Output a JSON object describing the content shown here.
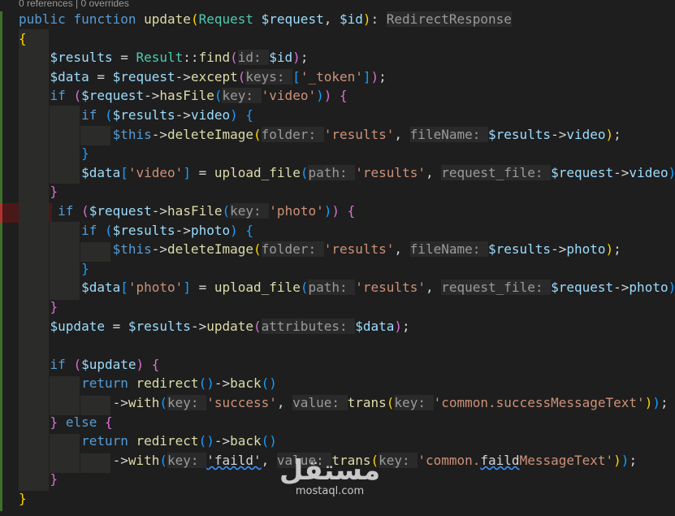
{
  "codelens": {
    "text": "0 references | 0 overrides"
  },
  "colors": {
    "background": "#1e1e1e",
    "keyword": "#569cd6",
    "function": "#dcdcaa",
    "class": "#4ec9b0",
    "variable": "#9cdcfe",
    "string": "#ce9178",
    "inlay_hint": "#9a9a9a",
    "bracket_gold": "#ffd700",
    "bracket_purple": "#da70d6",
    "bracket_blue": "#179fff",
    "gutter_modified": "#3f6f29",
    "gutter_deleted": "#b0342c"
  },
  "watermark": {
    "logo": "مستقل",
    "url": "mostaql.com"
  },
  "code_lines": [
    [
      [
        "kw",
        "public "
      ],
      [
        "kw",
        "function "
      ],
      [
        "fn",
        "update"
      ],
      [
        "b1",
        "("
      ],
      [
        "cls",
        "Request "
      ],
      [
        "var",
        "$request"
      ],
      [
        "p",
        ", "
      ],
      [
        "var",
        "$id"
      ],
      [
        "b1",
        ")"
      ],
      [
        "p",
        ": "
      ],
      [
        "hint",
        "RedirectResponse"
      ]
    ],
    [
      [
        "b1",
        "{"
      ]
    ],
    [
      [
        "p",
        "    "
      ],
      [
        "var",
        "$results"
      ],
      [
        "p",
        " = "
      ],
      [
        "cls",
        "Result"
      ],
      [
        "p",
        "::"
      ],
      [
        "fn",
        "find"
      ],
      [
        "b2",
        "("
      ],
      [
        "hint",
        "id: "
      ],
      [
        "var",
        "$id"
      ],
      [
        "b2",
        ")"
      ],
      [
        "p",
        ";"
      ]
    ],
    [
      [
        "p",
        "    "
      ],
      [
        "var",
        "$data"
      ],
      [
        "p",
        " = "
      ],
      [
        "var",
        "$request"
      ],
      [
        "p",
        "->"
      ],
      [
        "fn",
        "except"
      ],
      [
        "b2",
        "("
      ],
      [
        "hint",
        "keys: "
      ],
      [
        "b3",
        "["
      ],
      [
        "str",
        "'_token'"
      ],
      [
        "b3",
        "]"
      ],
      [
        "b2",
        ")"
      ],
      [
        "p",
        ";"
      ]
    ],
    [
      [
        "p",
        "    "
      ],
      [
        "kw",
        "if "
      ],
      [
        "b2",
        "("
      ],
      [
        "var",
        "$request"
      ],
      [
        "p",
        "->"
      ],
      [
        "fn",
        "hasFile"
      ],
      [
        "b3",
        "("
      ],
      [
        "hint",
        "key: "
      ],
      [
        "str",
        "'video'"
      ],
      [
        "b3",
        ")"
      ],
      [
        "b2",
        ")"
      ],
      [
        "p",
        " "
      ],
      [
        "b2",
        "{"
      ]
    ],
    [
      [
        "p",
        "        "
      ],
      [
        "kw",
        "if "
      ],
      [
        "b3",
        "("
      ],
      [
        "var",
        "$results"
      ],
      [
        "p",
        "->"
      ],
      [
        "var",
        "video"
      ],
      [
        "b3",
        ")"
      ],
      [
        "p",
        " "
      ],
      [
        "b3",
        "{"
      ]
    ],
    [
      [
        "p",
        "            "
      ],
      [
        "kw",
        "$this"
      ],
      [
        "p",
        "->"
      ],
      [
        "fn",
        "deleteImage"
      ],
      [
        "b1",
        "("
      ],
      [
        "hint",
        "folder: "
      ],
      [
        "str",
        "'results'"
      ],
      [
        "p",
        ", "
      ],
      [
        "hint",
        "fileName: "
      ],
      [
        "var",
        "$results"
      ],
      [
        "p",
        "->"
      ],
      [
        "var",
        "video"
      ],
      [
        "b1",
        ")"
      ],
      [
        "p",
        ";"
      ]
    ],
    [
      [
        "p",
        "        "
      ],
      [
        "b3",
        "}"
      ]
    ],
    [
      [
        "p",
        "        "
      ],
      [
        "var",
        "$data"
      ],
      [
        "b3",
        "["
      ],
      [
        "str",
        "'video'"
      ],
      [
        "b3",
        "]"
      ],
      [
        "p",
        " = "
      ],
      [
        "fn",
        "upload_file"
      ],
      [
        "b3",
        "("
      ],
      [
        "hint",
        "path: "
      ],
      [
        "str",
        "'results'"
      ],
      [
        "p",
        ", "
      ],
      [
        "hint",
        "request_file: "
      ],
      [
        "var",
        "$request"
      ],
      [
        "p",
        "->"
      ],
      [
        "var",
        "video"
      ],
      [
        "b3",
        ")"
      ]
    ],
    [
      [
        "p",
        "    "
      ],
      [
        "b2",
        "}"
      ]
    ],
    [
      [
        "p",
        "     "
      ],
      [
        "kw",
        "if "
      ],
      [
        "b2",
        "("
      ],
      [
        "var",
        "$request"
      ],
      [
        "p",
        "->"
      ],
      [
        "fn",
        "hasFile"
      ],
      [
        "b3",
        "("
      ],
      [
        "hint",
        "key: "
      ],
      [
        "str",
        "'photo'"
      ],
      [
        "b3",
        ")"
      ],
      [
        "b2",
        ")"
      ],
      [
        "p",
        " "
      ],
      [
        "b2",
        "{"
      ]
    ],
    [
      [
        "p",
        "        "
      ],
      [
        "kw",
        "if "
      ],
      [
        "b3",
        "("
      ],
      [
        "var",
        "$results"
      ],
      [
        "p",
        "->"
      ],
      [
        "var",
        "photo"
      ],
      [
        "b3",
        ")"
      ],
      [
        "p",
        " "
      ],
      [
        "b3",
        "{"
      ]
    ],
    [
      [
        "p",
        "            "
      ],
      [
        "kw",
        "$this"
      ],
      [
        "p",
        "->"
      ],
      [
        "fn",
        "deleteImage"
      ],
      [
        "b1",
        "("
      ],
      [
        "hint",
        "folder: "
      ],
      [
        "str",
        "'results'"
      ],
      [
        "p",
        ", "
      ],
      [
        "hint",
        "fileName: "
      ],
      [
        "var",
        "$results"
      ],
      [
        "p",
        "->"
      ],
      [
        "var",
        "photo"
      ],
      [
        "b1",
        ")"
      ],
      [
        "p",
        ";"
      ]
    ],
    [
      [
        "p",
        "        "
      ],
      [
        "b3",
        "}"
      ]
    ],
    [
      [
        "p",
        "        "
      ],
      [
        "var",
        "$data"
      ],
      [
        "b3",
        "["
      ],
      [
        "str",
        "'photo'"
      ],
      [
        "b3",
        "]"
      ],
      [
        "p",
        " = "
      ],
      [
        "fn",
        "upload_file"
      ],
      [
        "b3",
        "("
      ],
      [
        "hint",
        "path: "
      ],
      [
        "str",
        "'results'"
      ],
      [
        "p",
        ", "
      ],
      [
        "hint",
        "request_file: "
      ],
      [
        "var",
        "$request"
      ],
      [
        "p",
        "->"
      ],
      [
        "var",
        "photo"
      ],
      [
        "b3",
        ")"
      ]
    ],
    [
      [
        "p",
        "    "
      ],
      [
        "b2",
        "}"
      ]
    ],
    [
      [
        "p",
        "    "
      ],
      [
        "var",
        "$update"
      ],
      [
        "p",
        " = "
      ],
      [
        "var",
        "$results"
      ],
      [
        "p",
        "->"
      ],
      [
        "fn",
        "update"
      ],
      [
        "b2",
        "("
      ],
      [
        "hint",
        "attributes: "
      ],
      [
        "var",
        "$data"
      ],
      [
        "b2",
        ")"
      ],
      [
        "p",
        ";"
      ]
    ],
    [],
    [
      [
        "p",
        "    "
      ],
      [
        "kw",
        "if "
      ],
      [
        "b2",
        "("
      ],
      [
        "var",
        "$update"
      ],
      [
        "b2",
        ")"
      ],
      [
        "p",
        " "
      ],
      [
        "b2",
        "{"
      ]
    ],
    [
      [
        "p",
        "        "
      ],
      [
        "kw",
        "return "
      ],
      [
        "fn",
        "redirect"
      ],
      [
        "b3",
        "()"
      ],
      [
        "p",
        "->"
      ],
      [
        "fn",
        "back"
      ],
      [
        "b3",
        "()"
      ]
    ],
    [
      [
        "p",
        "            ->"
      ],
      [
        "fn",
        "with"
      ],
      [
        "b3",
        "("
      ],
      [
        "hint",
        "key: "
      ],
      [
        "str",
        "'success'"
      ],
      [
        "p",
        ", "
      ],
      [
        "hint",
        "value: "
      ],
      [
        "fn",
        "trans"
      ],
      [
        "b1",
        "("
      ],
      [
        "hint",
        "key: "
      ],
      [
        "str",
        "'common.successMessageText'"
      ],
      [
        "b1",
        ")"
      ],
      [
        "b3",
        ")"
      ],
      [
        "p",
        ";"
      ]
    ],
    [
      [
        "p",
        "    "
      ],
      [
        "b2",
        "}"
      ],
      [
        "p",
        " "
      ],
      [
        "kw",
        "else "
      ],
      [
        "b2",
        "{"
      ]
    ],
    [
      [
        "p",
        "        "
      ],
      [
        "kw",
        "return "
      ],
      [
        "fn",
        "redirect"
      ],
      [
        "b3",
        "()"
      ],
      [
        "p",
        "->"
      ],
      [
        "fn",
        "back"
      ],
      [
        "b3",
        "()"
      ]
    ],
    [
      [
        "p",
        "            ->"
      ],
      [
        "fn",
        "with"
      ],
      [
        "b3",
        "("
      ],
      [
        "hint",
        "key: "
      ],
      [
        "sq",
        "'faild'"
      ],
      [
        "p",
        ", "
      ],
      [
        "hint",
        "value: "
      ],
      [
        "fn",
        "trans"
      ],
      [
        "b1",
        "("
      ],
      [
        "hint",
        "key: "
      ],
      [
        "str",
        "'common."
      ],
      [
        "sq",
        "faild"
      ],
      [
        "str",
        "MessageText'"
      ],
      [
        "b1",
        ")"
      ],
      [
        "b3",
        ")"
      ],
      [
        "p",
        ";"
      ]
    ],
    [
      [
        "p",
        "    "
      ],
      [
        "b2",
        "}"
      ]
    ],
    [
      [
        "b1",
        "}"
      ]
    ]
  ]
}
